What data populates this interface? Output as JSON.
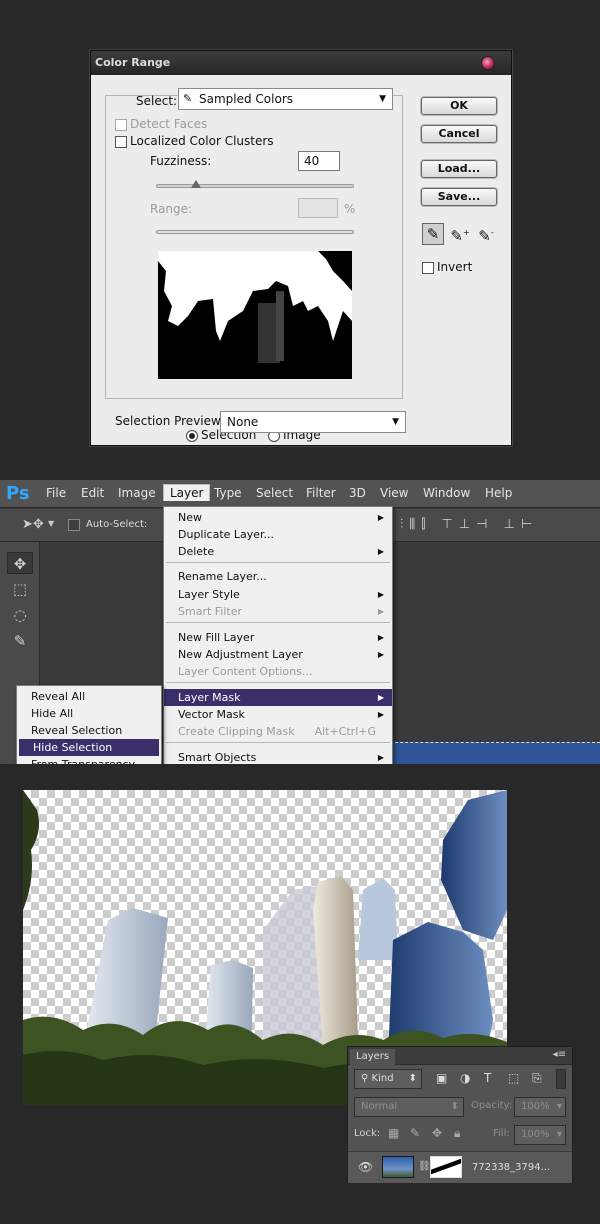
{
  "color_range": {
    "title": "Color Range",
    "select_label": "Select:",
    "select_value": "Sampled Colors",
    "detect_faces": "Detect Faces",
    "localized": "Localized Color Clusters",
    "fuzziness_label": "Fuzziness:",
    "fuzziness_value": "40",
    "fuzziness_level": 0.2,
    "range_label": "Range:",
    "range_unit": "%",
    "radio_selection": "Selection",
    "radio_image": "Image",
    "preview_label": "Selection Preview:",
    "preview_value": "None",
    "buttons": {
      "ok": "OK",
      "cancel": "Cancel",
      "load": "Load...",
      "save": "Save..."
    },
    "invert": "Invert"
  },
  "ps": {
    "logo": "Ps",
    "menus": [
      "File",
      "Edit",
      "Image",
      "Layer",
      "Type",
      "Select",
      "Filter",
      "3D",
      "View",
      "Window",
      "Help"
    ],
    "auto_select": "Auto-Select:",
    "layer_menu": {
      "new": "New",
      "duplicate": "Duplicate Layer...",
      "delete": "Delete",
      "rename": "Rename Layer...",
      "style": "Layer Style",
      "smart_filter": "Smart Filter",
      "new_fill": "New Fill Layer",
      "new_adjustment": "New Adjustment Layer",
      "content_options": "Layer Content Options...",
      "layer_mask": "Layer Mask",
      "vector_mask": "Vector Mask",
      "clipping_mask": "Create Clipping Mask",
      "clipping_shortcut": "Alt+Ctrl+G",
      "smart_objects": "Smart Objects"
    },
    "mask_submenu": {
      "reveal_all": "Reveal All",
      "hide_all": "Hide All",
      "reveal_selection": "Reveal Selection",
      "hide_selection": "Hide Selection",
      "from_transparency": "From Transparency"
    }
  },
  "layers_panel": {
    "tab": "Layers",
    "kind": "Kind",
    "blend_mode": "Normal",
    "opacity_label": "Opacity:",
    "opacity_value": "100%",
    "lock_label": "Lock:",
    "fill_label": "Fill:",
    "fill_value": "100%",
    "layer_name": "772338_3794..."
  },
  "colors": {
    "highlight": "#3a2f6b",
    "ps_blue": "#31a8ff",
    "selection_strip": "#2e5597"
  }
}
